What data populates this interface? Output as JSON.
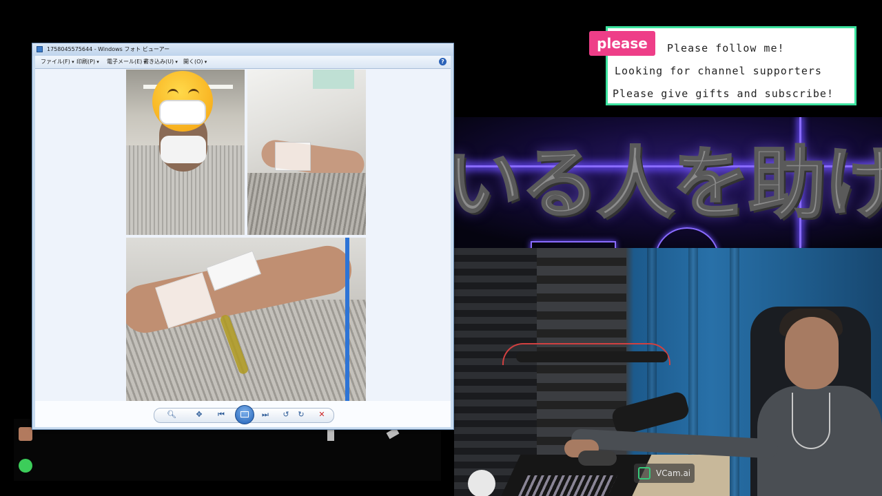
{
  "viewer": {
    "title": "1758045575644 - Windows フォト ビューアー",
    "menu": [
      "ファイル(F)",
      "印刷(P)",
      "電子メール(E)",
      "書き込み(U)",
      "開く(O)"
    ],
    "help": "?"
  },
  "banner": {
    "text": "いる人を助ける"
  },
  "please": {
    "tag": "please",
    "lines": [
      "Please follow me!",
      "Looking for channel supporters",
      "Please give gifts and subscribe!"
    ],
    "accent": "#3be39f",
    "tag_color": "#ee3e88"
  },
  "cam": {
    "badge": "VCam.ai"
  },
  "toolbar_icons": [
    "zoom-icon",
    "fit-icon",
    "previous-icon",
    "slideshow-icon",
    "next-icon",
    "rotate-left-icon",
    "rotate-right-icon",
    "delete-icon"
  ],
  "colors": {
    "neon": "#8a6cff",
    "viewer_frame": "#c9dcf0",
    "ui_blue": "#2b5a97"
  }
}
